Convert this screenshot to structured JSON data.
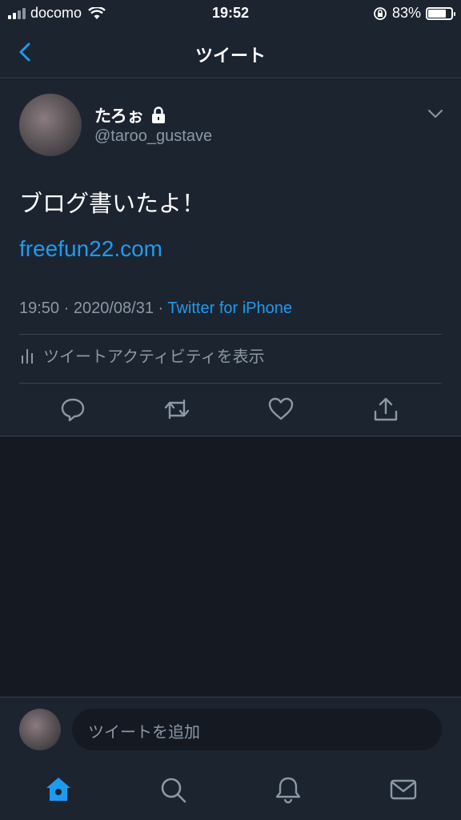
{
  "status_bar": {
    "carrier": "docomo",
    "time": "19:52",
    "battery": "83%"
  },
  "nav": {
    "title": "ツイート"
  },
  "tweet": {
    "display_name": "たろぉ",
    "handle": "@taroo_gustave",
    "text": "ブログ書いたよ！",
    "link": "freefun22.com",
    "time": "19:50",
    "date": "2020/08/31",
    "source": "Twitter for iPhone",
    "activity_label": "ツイートアクティビティを表示"
  },
  "compose": {
    "placeholder": "ツイートを追加"
  },
  "colors": {
    "accent": "#1d9bf0",
    "background": "#141922",
    "surface": "#1c2430",
    "muted": "#8b98a5"
  },
  "icons": [
    "back-arrow-icon",
    "lock-icon",
    "chevron-down-icon",
    "activity-icon",
    "reply-icon",
    "retweet-icon",
    "like-icon",
    "share-icon",
    "home-icon",
    "search-icon",
    "notifications-icon",
    "messages-icon"
  ]
}
